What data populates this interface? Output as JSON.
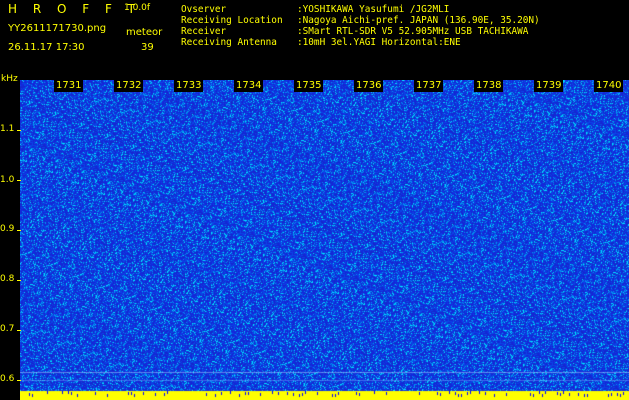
{
  "header": {
    "app_title": "H R O F F T",
    "version": "1.0.0f",
    "filename": "YY2611171730.png",
    "meteor_label": "meteor",
    "datetime": "26.11.17 17:30",
    "meteor_count": "39"
  },
  "info": [
    {
      "key": "Ovserver",
      "value": ":YOSHIKAWA Yasufumi /JG2MLI"
    },
    {
      "key": "Receiving Location",
      "value": ":Nagoya Aichi-pref. JAPAN (136.90E, 35.20N)"
    },
    {
      "key": "Receiver",
      "value": ":SMart RTL-SDR V5 52.905MHz USB TACHIKAWA"
    },
    {
      "key": "Receiving Antenna",
      "value": ":10mH 3el.YAGI Horizontal:ENE"
    }
  ],
  "y_axis": {
    "unit": "kHz",
    "ticks": [
      "1.1",
      "1.0",
      "0.9",
      "0.8",
      "0.7",
      "0.6"
    ]
  },
  "x_axis": {
    "ticks": [
      "1731",
      "1732",
      "1733",
      "1734",
      "1735",
      "1736",
      "1737",
      "1738",
      "1739",
      "1740"
    ]
  },
  "colors": {
    "text": "#ffff00",
    "background": "#000000",
    "noise_base": "#1a2fd8",
    "noise_hot": "#00e5ff"
  }
}
